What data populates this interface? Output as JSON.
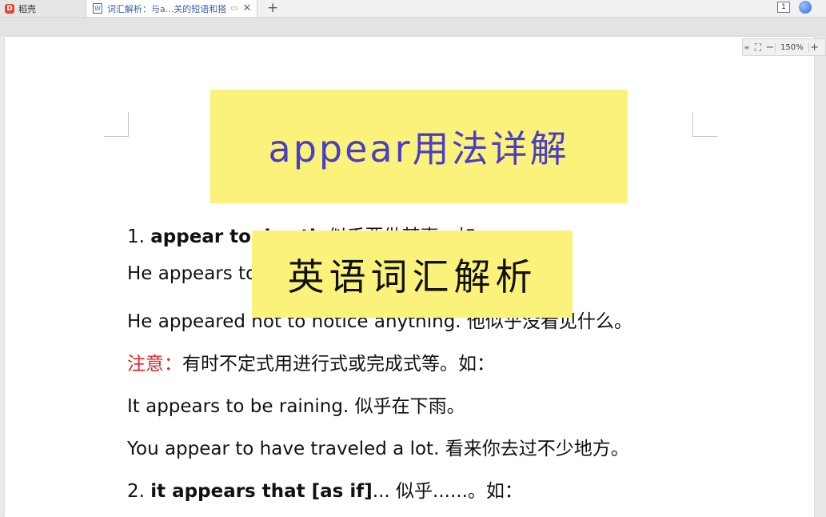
{
  "tabs": {
    "home_label": "稻壳",
    "doc_title": "词汇解析：与a...关的短语和搭配"
  },
  "tabbar": {
    "new_tab": "+",
    "window_badge": "1"
  },
  "zoom": {
    "value": "150%",
    "minus": "−",
    "plus": "+"
  },
  "document": {
    "title": "appear用法详解",
    "overlay": "英语词汇解析",
    "lines": [
      {
        "num": "1. ",
        "bold": "appear to do sth",
        "text": " 似乎要做某事。如："
      },
      {
        "text": "He appears to"
      },
      {
        "text": "He appeared not to notice anything. 他似乎没看见什么。"
      },
      {
        "label": "注意：",
        "text": "有时不定式用进行式或完成式等。如："
      },
      {
        "text": "It appears to be raining. 似乎在下雨。"
      },
      {
        "text": "You appear to have traveled a lot. 看来你去过不少地方。"
      },
      {
        "num": "2. ",
        "bold": "it appears that [as if]",
        "text": "... 似乎......。如："
      }
    ]
  },
  "colors": {
    "highlight": "#faf27a",
    "title": "#4a3fc4",
    "note": "#e02424"
  }
}
